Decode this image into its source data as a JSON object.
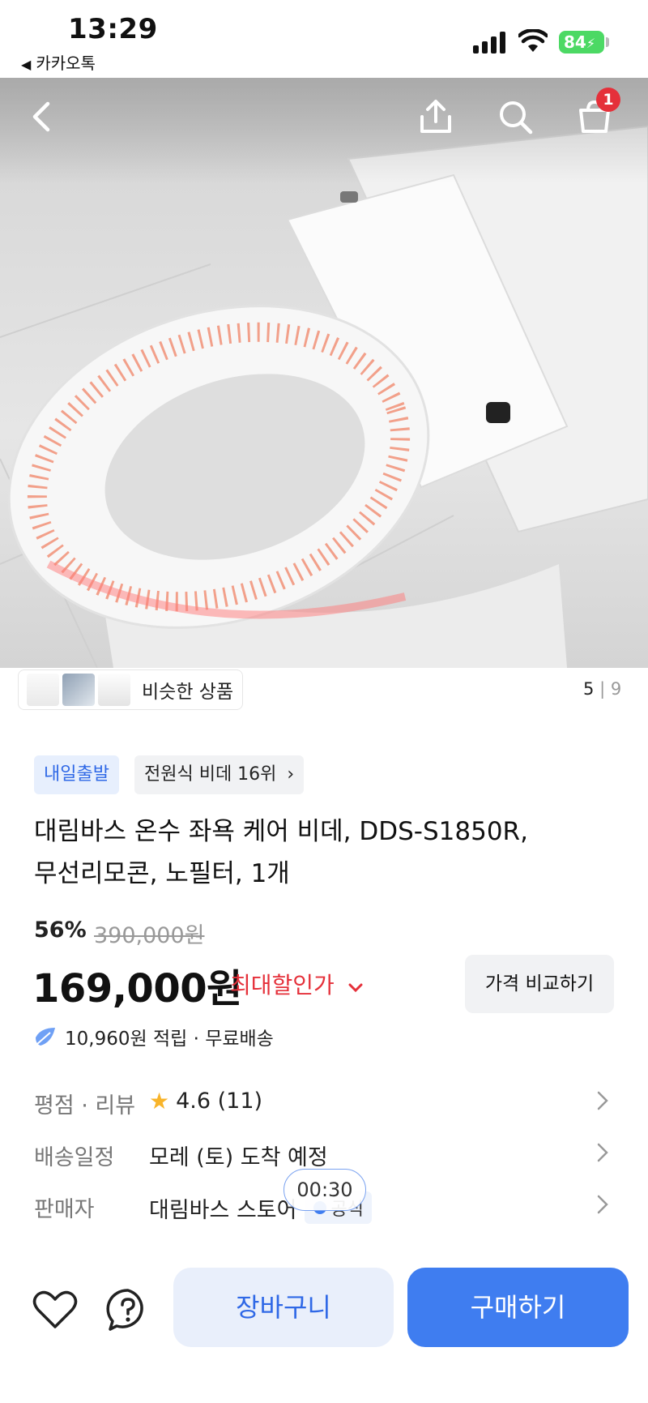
{
  "status_bar": {
    "time": "13:29",
    "back_app": "카카오톡",
    "battery": "84"
  },
  "header": {
    "cart_count": "1"
  },
  "gallery": {
    "similar_label": "비슷한 상품",
    "current_index": "5",
    "separator": "|",
    "total": "9"
  },
  "tags": {
    "shipping": "내일출발",
    "ranking": "전원식 비데 16위"
  },
  "product": {
    "title_line1": "대림바스 온수 좌욕 케어 비데, DDS-S1850R,",
    "title_line2": "무선리모콘, 노필터, 1개"
  },
  "pricing": {
    "discount_rate": "56%",
    "original_price": "390,000원",
    "price": "169,000원",
    "max_discount_label": "최대할인가",
    "compare_button": "가격 비교하기",
    "points": "10,960원 적립 · 무료배송"
  },
  "info": {
    "rating_label": "평점 · 리뷰",
    "rating_value": "4.6 (11)",
    "delivery_label": "배송일정",
    "delivery_value": "모레 (토) 도착 예정",
    "seller_label": "판매자",
    "seller_value": "대림바스 스토어",
    "official_badge": "공식"
  },
  "timer": "00:30",
  "bottom_bar": {
    "cart_button": "장바구니",
    "buy_button": "구매하기"
  },
  "colors": {
    "accent": "#3f7df0",
    "sale_red": "#e5303a",
    "badge_red": "#e5303a"
  }
}
